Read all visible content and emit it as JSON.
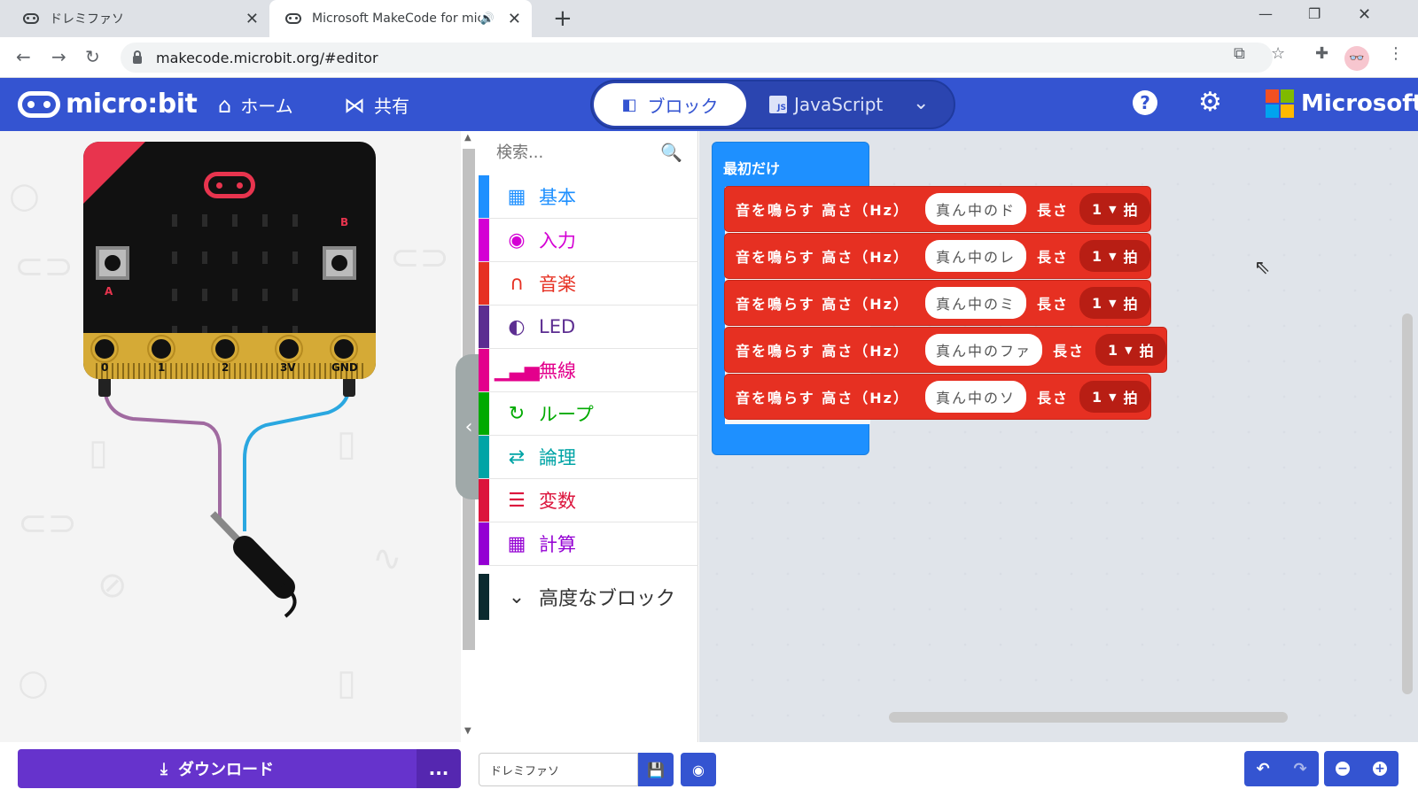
{
  "browser": {
    "tabs": [
      {
        "title": "ドレミファソ",
        "active": false
      },
      {
        "title": "Microsoft MakeCode for micro:bit",
        "active": true
      }
    ],
    "url": "makecode.microbit.org/#editor",
    "icons": {
      "back": "back-arrow-icon",
      "forward": "forward-arrow-icon",
      "reload": "reload-icon",
      "translate": "translate-icon",
      "star": "bookmark-star-icon",
      "extensions": "puzzle-piece-icon",
      "menu": "kebab-menu-icon"
    }
  },
  "header": {
    "logo": "micro:bit",
    "home_label": "ホーム",
    "share_label": "共有",
    "blocks_label": "ブロック",
    "javascript_label": "JavaScript",
    "brand": "Microsoft",
    "brand_colors": [
      "#f25022",
      "#7fba00",
      "#00a4ef",
      "#ffb900"
    ],
    "accent": "#3454d1"
  },
  "simulator": {
    "button_a": "A",
    "button_b": "B",
    "pins": [
      "0",
      "1",
      "2",
      "3V",
      "GND"
    ]
  },
  "toolbox": {
    "search_placeholder": "検索...",
    "categories": [
      {
        "label": "基本",
        "icon": "grid-icon",
        "color": "#1e90ff"
      },
      {
        "label": "入力",
        "icon": "target-icon",
        "color": "#d400d4"
      },
      {
        "label": "音楽",
        "icon": "headphones-icon",
        "color": "#e63022"
      },
      {
        "label": "LED",
        "icon": "toggle-icon",
        "color": "#5c2d91"
      },
      {
        "label": "無線",
        "icon": "signal-bars-icon",
        "color": "#e3008c"
      },
      {
        "label": "ループ",
        "icon": "refresh-icon",
        "color": "#00aa00"
      },
      {
        "label": "論理",
        "icon": "shuffle-icon",
        "color": "#00a4a6"
      },
      {
        "label": "変数",
        "icon": "lines-icon",
        "color": "#dc143c"
      },
      {
        "label": "計算",
        "icon": "calculator-icon",
        "color": "#9400d3"
      }
    ],
    "advanced_label": "高度なブロック"
  },
  "workspace": {
    "start_block_label": "最初だけ",
    "tone_blocks": [
      {
        "text": "音を鳴らす 高さ（Hz）",
        "note": "真ん中のド",
        "length_label": "長さ",
        "beats": "1",
        "beat_unit": "拍"
      },
      {
        "text": "音を鳴らす 高さ（Hz）",
        "note": "真ん中のレ",
        "length_label": "長さ",
        "beats": "1",
        "beat_unit": "拍"
      },
      {
        "text": "音を鳴らす 高さ（Hz）",
        "note": "真ん中のミ",
        "length_label": "長さ",
        "beats": "1",
        "beat_unit": "拍"
      },
      {
        "text": "音を鳴らす 高さ（Hz）",
        "note": "真ん中のファ",
        "length_label": "長さ",
        "beats": "1",
        "beat_unit": "拍"
      },
      {
        "text": "音を鳴らす 高さ（Hz）",
        "note": "真ん中のソ",
        "length_label": "長さ",
        "beats": "1",
        "beat_unit": "拍"
      }
    ]
  },
  "bottom": {
    "download_label": "ダウンロード",
    "more_label": "...",
    "project_name": "ドレミファソ"
  }
}
